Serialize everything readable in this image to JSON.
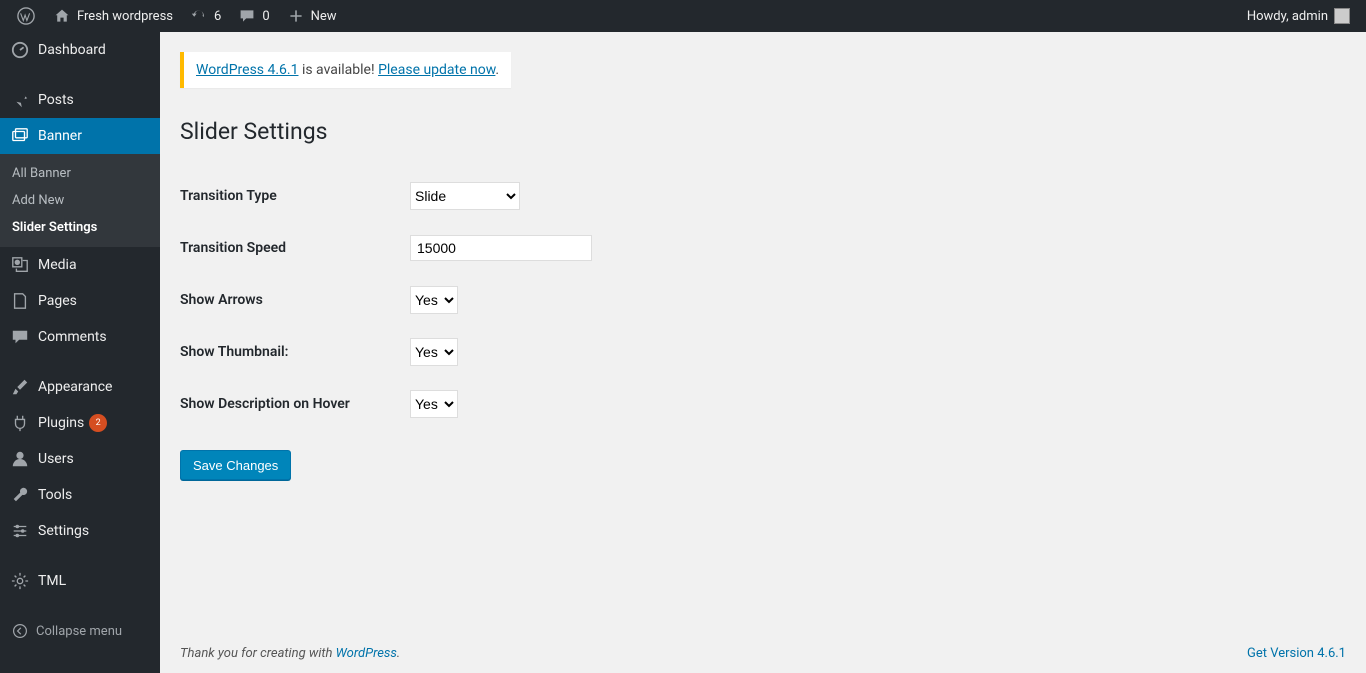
{
  "adminbar": {
    "site_name": "Fresh wordpress",
    "updates_count": "6",
    "comments_count": "0",
    "new_label": "New",
    "howdy": "Howdy, admin"
  },
  "sidebar": {
    "items": [
      {
        "id": "dashboard",
        "label": "Dashboard"
      },
      {
        "id": "posts",
        "label": "Posts"
      },
      {
        "id": "banner",
        "label": "Banner"
      },
      {
        "id": "media",
        "label": "Media"
      },
      {
        "id": "pages",
        "label": "Pages"
      },
      {
        "id": "comments",
        "label": "Comments"
      },
      {
        "id": "appearance",
        "label": "Appearance"
      },
      {
        "id": "plugins",
        "label": "Plugins",
        "badge": "2"
      },
      {
        "id": "users",
        "label": "Users"
      },
      {
        "id": "tools",
        "label": "Tools"
      },
      {
        "id": "settings",
        "label": "Settings"
      },
      {
        "id": "tml",
        "label": "TML"
      }
    ],
    "banner_submenu": [
      {
        "label": "All Banner"
      },
      {
        "label": "Add New"
      },
      {
        "label": "Slider Settings",
        "current": true
      }
    ],
    "collapse_label": "Collapse menu"
  },
  "notice": {
    "link1": "WordPress 4.6.1",
    "mid": " is available! ",
    "link2": "Please update now",
    "tail": "."
  },
  "page": {
    "title": "Slider Settings",
    "fields": {
      "transition_type": {
        "label": "Transition Type",
        "value": "Slide"
      },
      "transition_speed": {
        "label": "Transition Speed",
        "value": "15000"
      },
      "show_arrows": {
        "label": "Show Arrows",
        "value": "Yes"
      },
      "show_thumbnail": {
        "label": "Show Thumbnail:",
        "value": "Yes"
      },
      "show_description": {
        "label": "Show Description on Hover",
        "value": "Yes"
      }
    },
    "submit_label": "Save Changes"
  },
  "footer": {
    "thanks_pre": "Thank you for creating with ",
    "thanks_link": "WordPress",
    "thanks_post": ".",
    "version": "Get Version 4.6.1"
  }
}
